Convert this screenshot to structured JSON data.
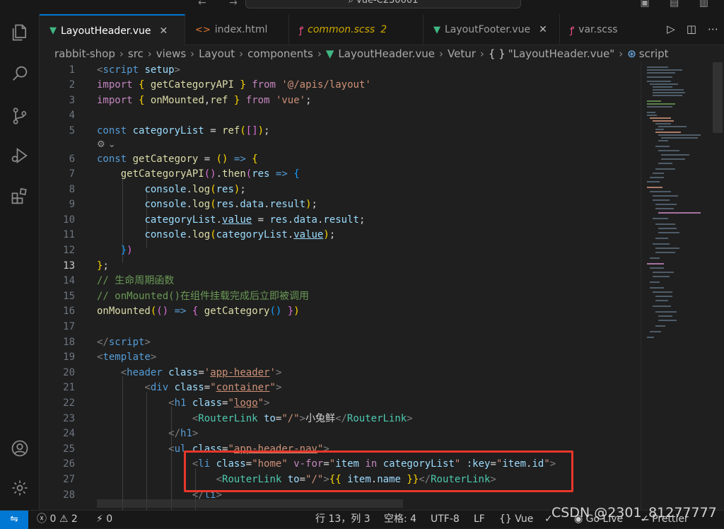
{
  "titlebar": {
    "command_center": "vue-C230601"
  },
  "tabs": [
    {
      "label": "LayoutHeader.vue",
      "icon": "vue-icon",
      "active": true
    },
    {
      "label": "index.html",
      "icon": "html-icon",
      "active": false
    },
    {
      "label": "common.scss",
      "icon": "scss-icon",
      "badge": "2",
      "active": false
    },
    {
      "label": "LayoutFooter.vue",
      "icon": "vue-icon",
      "active": false
    },
    {
      "label": "var.scss",
      "icon": "scss-icon",
      "active": false
    }
  ],
  "breadcrumb": {
    "items": [
      "rabbit-shop",
      "src",
      "views",
      "Layout",
      "components",
      "LayoutHeader.vue",
      "Vetur",
      "\"LayoutHeader.vue\"",
      "script"
    ]
  },
  "editor": {
    "current_line": "13",
    "line_numbers": [
      "1",
      "2",
      "3",
      "4",
      "5",
      "6",
      "7",
      "8",
      "9",
      "10",
      "11",
      "12",
      "13",
      "14",
      "15",
      "16",
      "17",
      "18",
      "19",
      "20",
      "21",
      "22",
      "23",
      "24",
      "25",
      "26",
      "27",
      "28"
    ],
    "comment_1": "// 生命周期函数",
    "comment_2": "// onMounted()在组件挂载完成后立即被调用",
    "router_link_text": "小兔鲜"
  },
  "statusbar": {
    "errors": "0",
    "warnings": "2",
    "ports": "0",
    "position": "行 13，列 3",
    "spaces": "空格: 4",
    "encoding": "UTF-8",
    "eol": "LF",
    "language": "Vue",
    "golive": "Go Live",
    "formatter": "Prettier"
  },
  "watermark": "CSDN @2301_81277777"
}
